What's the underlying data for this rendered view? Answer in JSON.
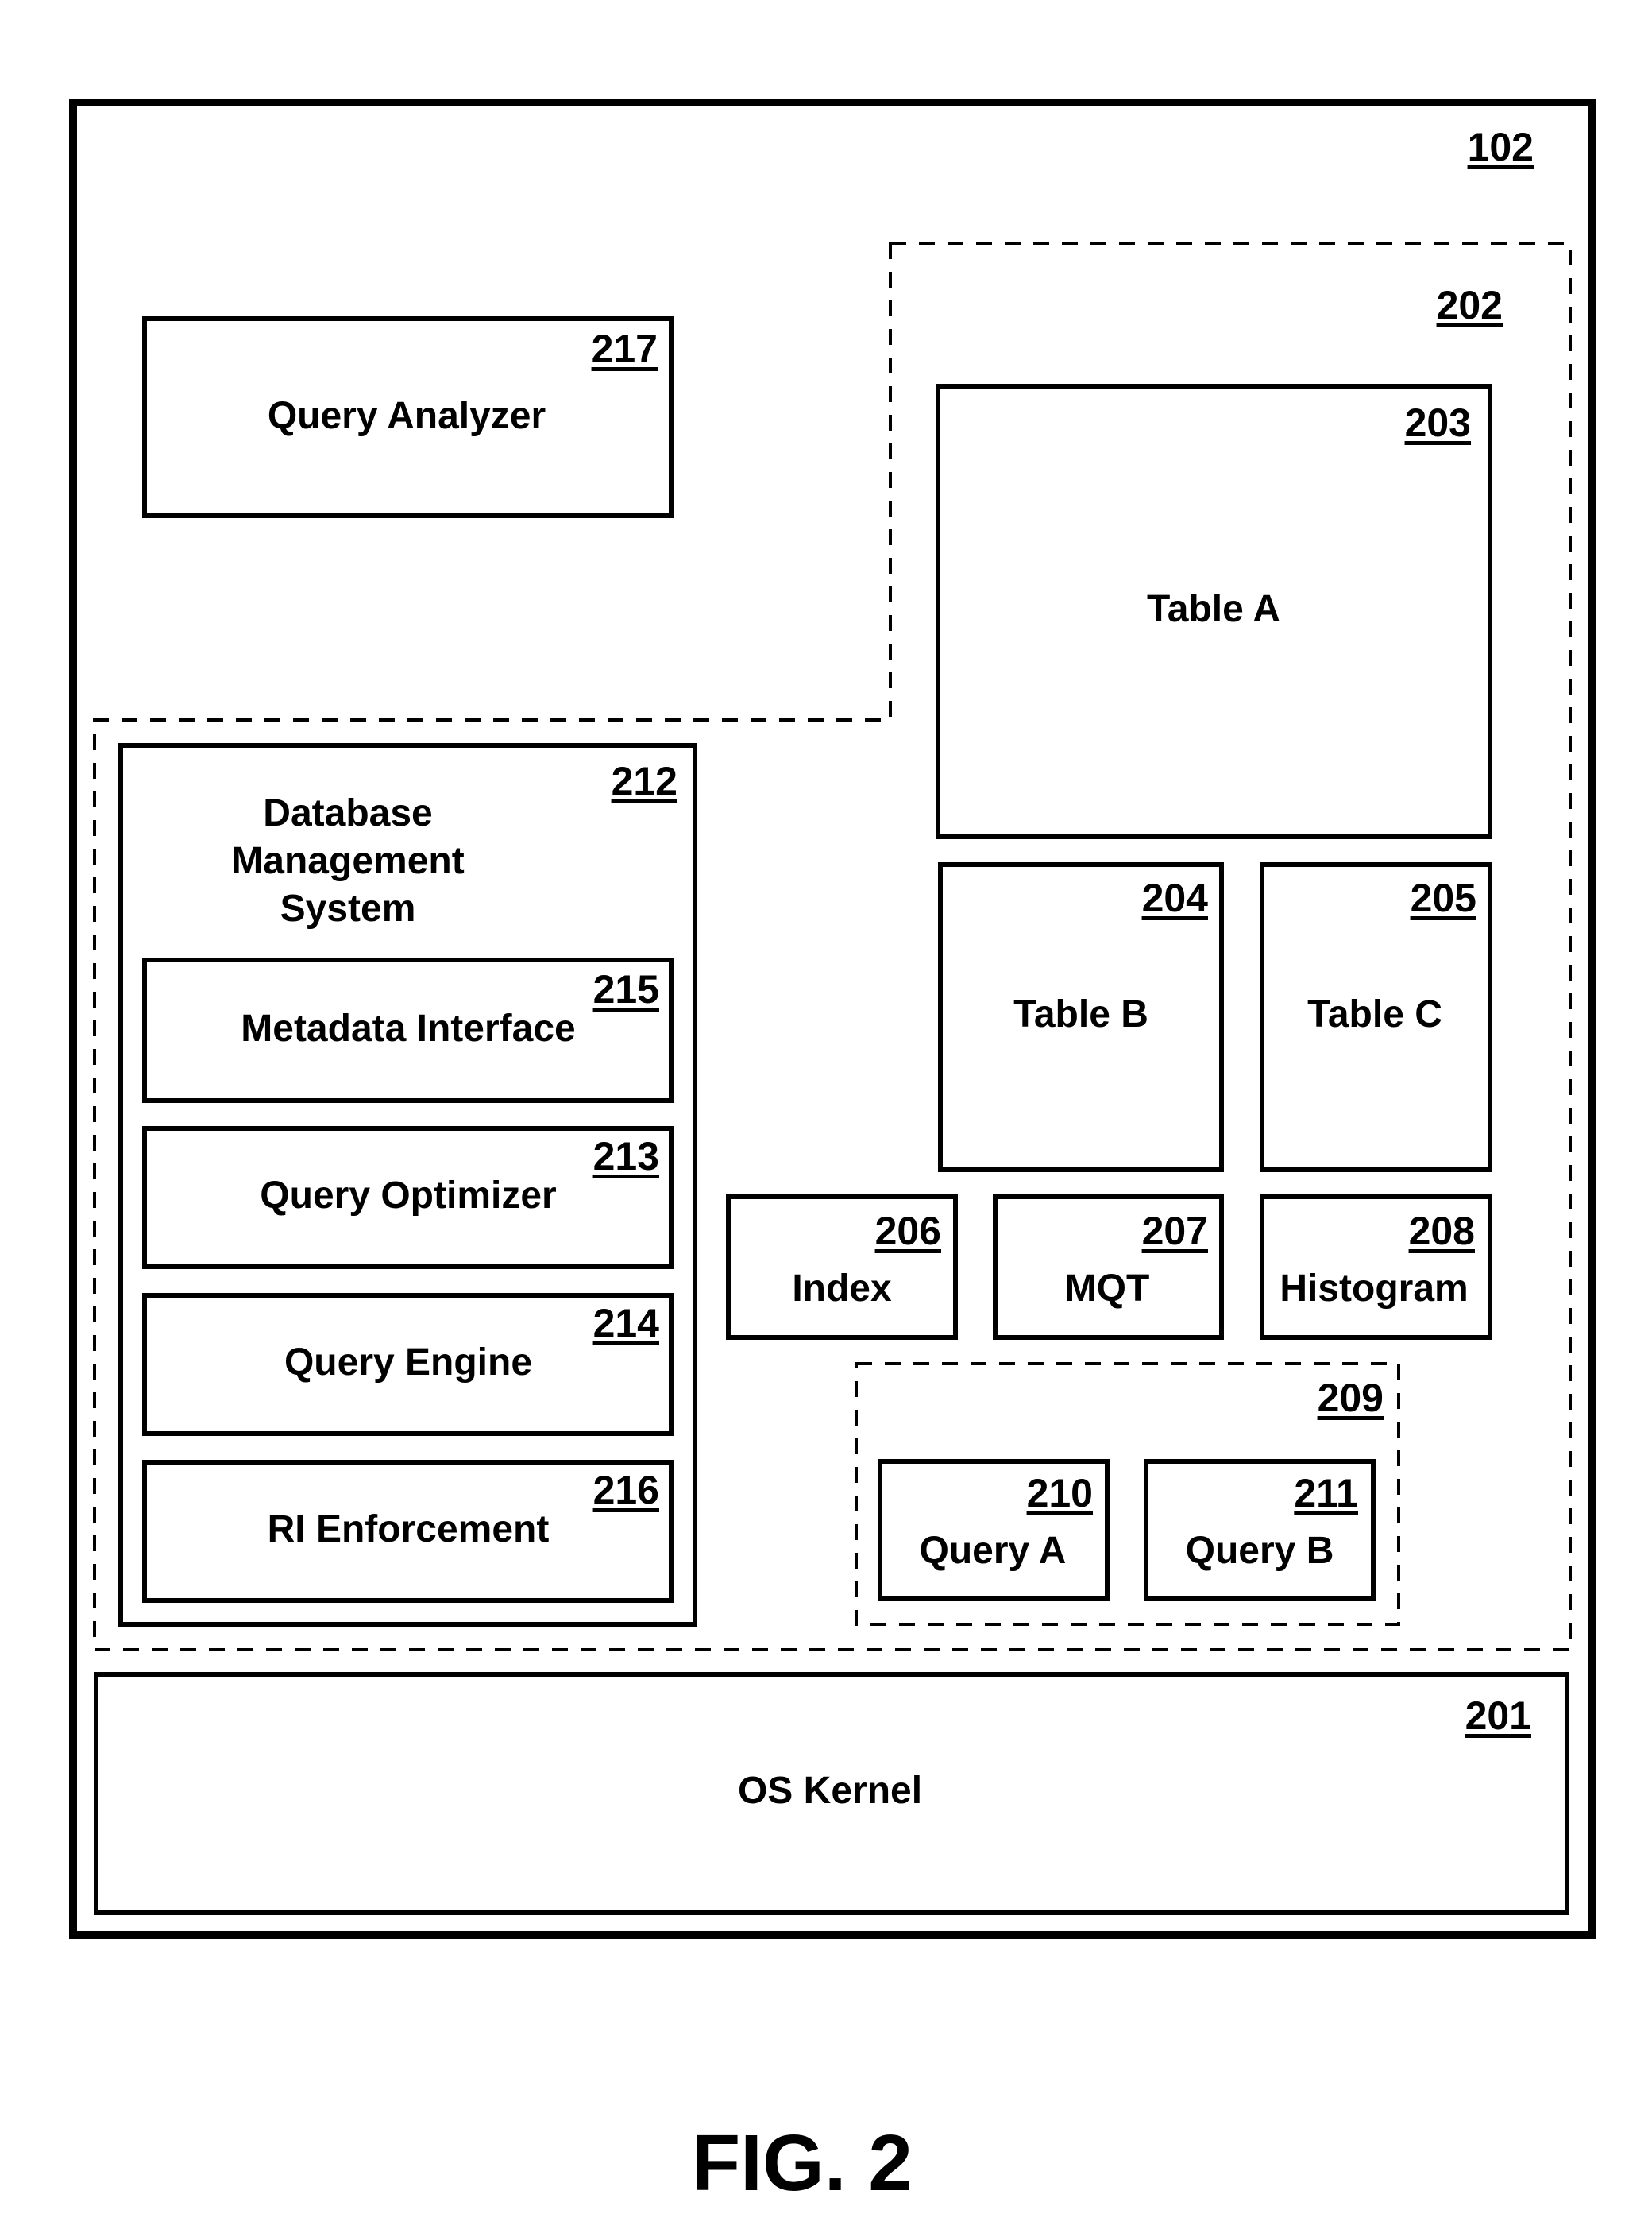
{
  "figure_caption": "FIG. 2",
  "computer": {
    "ref": "102"
  },
  "memory_region": {
    "ref": "202"
  },
  "query_analyzer": {
    "ref": "217",
    "label": "Query Analyzer"
  },
  "dbms": {
    "ref": "212",
    "label_lines": [
      "Database",
      "Management",
      "System"
    ],
    "components": [
      {
        "ref": "215",
        "label": "Metadata Interface"
      },
      {
        "ref": "213",
        "label": "Query Optimizer"
      },
      {
        "ref": "214",
        "label": "Query Engine"
      },
      {
        "ref": "216",
        "label": "RI Enforcement"
      }
    ]
  },
  "tables": [
    {
      "ref": "203",
      "label": "Table A"
    },
    {
      "ref": "204",
      "label": "Table B"
    },
    {
      "ref": "205",
      "label": "Table C"
    }
  ],
  "auxiliary": [
    {
      "ref": "206",
      "label": "Index"
    },
    {
      "ref": "207",
      "label": "MQT"
    },
    {
      "ref": "208",
      "label": "Histogram"
    }
  ],
  "queries_group": {
    "ref": "209",
    "queries": [
      {
        "ref": "210",
        "label": "Query A"
      },
      {
        "ref": "211",
        "label": "Query B"
      }
    ]
  },
  "os_kernel": {
    "ref": "201",
    "label": "OS Kernel"
  }
}
